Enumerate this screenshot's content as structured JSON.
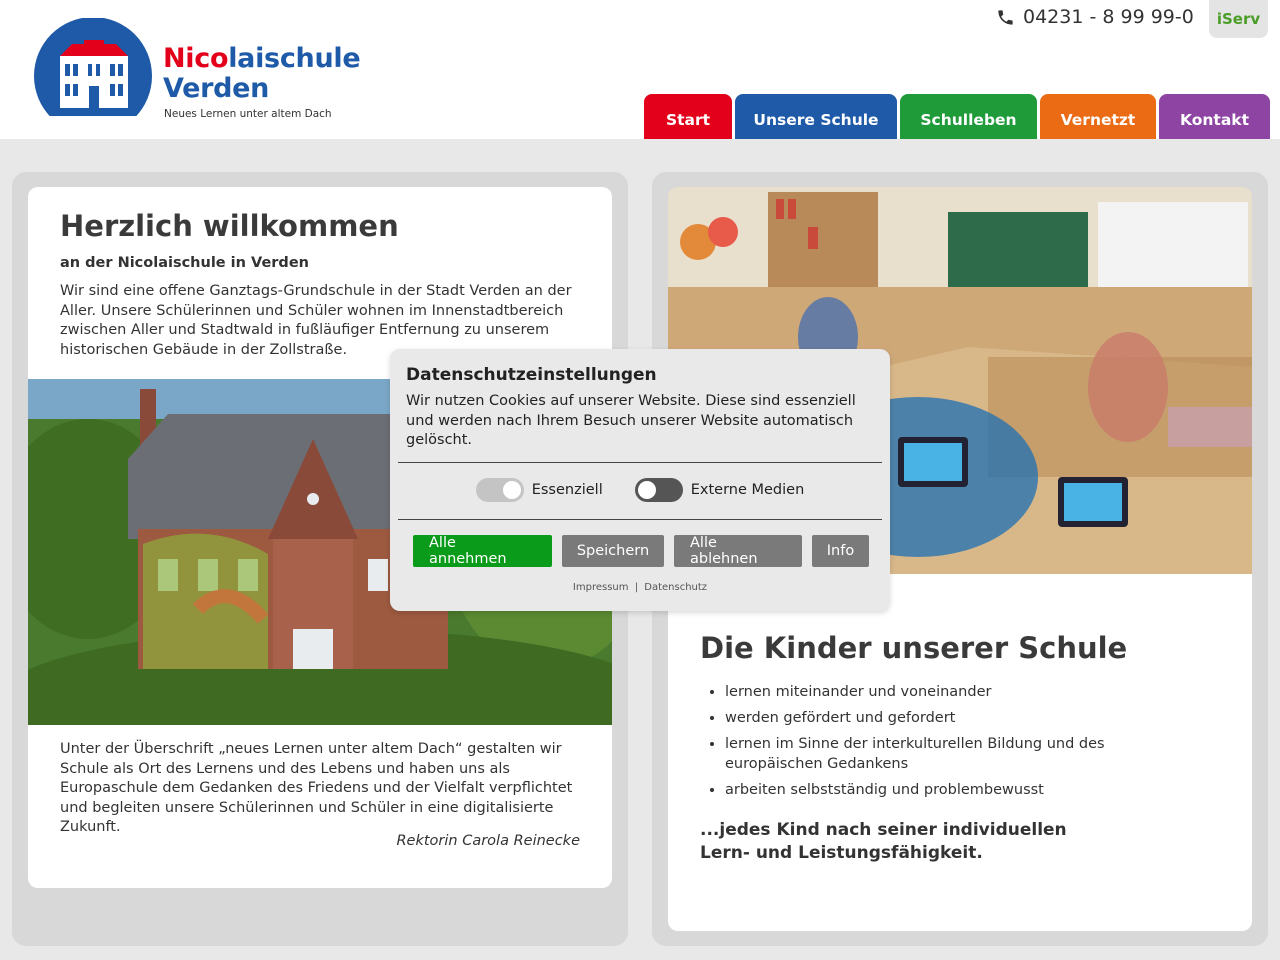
{
  "header": {
    "logo_name_red": "Nico",
    "logo_name_rest": "laischule",
    "logo_name_line2": "Verden",
    "tagline": "Neues Lernen unter altem Dach",
    "phone": "04231 - 8 99 99-0",
    "iserv": "iServ"
  },
  "nav": [
    {
      "label": "Start",
      "color": "#e2001a"
    },
    {
      "label": "Unsere Schule",
      "color": "#1e5aa8"
    },
    {
      "label": "Schulleben",
      "color": "#1f9b3a"
    },
    {
      "label": "Vernetzt",
      "color": "#ea6b13"
    },
    {
      "label": "Kontakt",
      "color": "#8e44a3"
    }
  ],
  "welcome": {
    "title": "Herzlich willkommen",
    "subtitle": "an der Nicolaischule in Verden",
    "text": "Wir sind eine offene Ganztags-Grundschule in der Stadt Verden an der Aller. Unsere Schülerinnen und Schüler wohnen im Innenstadtbereich zwischen Aller und Stadtwald in fußläufiger Entfernung zu unserem historischen Gebäude in der Zollstraße.",
    "bottom_text": "Unter der Überschrift „neues Lernen unter altem Dach“ gestalten wir Schule als Ort des Lernens und des Lebens und haben uns als Europaschule dem Gedanken des Friedens und der Vielfalt verpflichtet und begleiten unsere Schülerinnen und Schüler in eine digitalisierte Zukunft.",
    "signature": "Rektorin Carola Reinecke"
  },
  "kids": {
    "title": "Die Kinder unserer Schule",
    "items": [
      "lernen miteinander und voneinander",
      "werden gefördert und gefordert",
      "lernen im Sinne der interkulturellen Bildung und des europäischen Gedankens",
      "arbeiten selbstständig und problembewusst"
    ],
    "closing": "...jedes Kind nach seiner individuellen Lern- und Leistungsfähigkeit."
  },
  "cookie": {
    "title": "Datenschutzeinstellungen",
    "text": "Wir nutzen Cookies auf unserer Website. Diese sind essenziell und werden nach Ihrem Besuch unserer Website automatisch gelöscht.",
    "toggle_essential": "Essenziell",
    "toggle_external": "Externe Medien",
    "btn_accept": "Alle annehmen",
    "btn_save": "Speichern",
    "btn_reject": "Alle ablehnen",
    "btn_info": "Info",
    "link_impressum": "Impressum",
    "link_separator": "|",
    "link_datenschutz": "Datenschutz"
  }
}
